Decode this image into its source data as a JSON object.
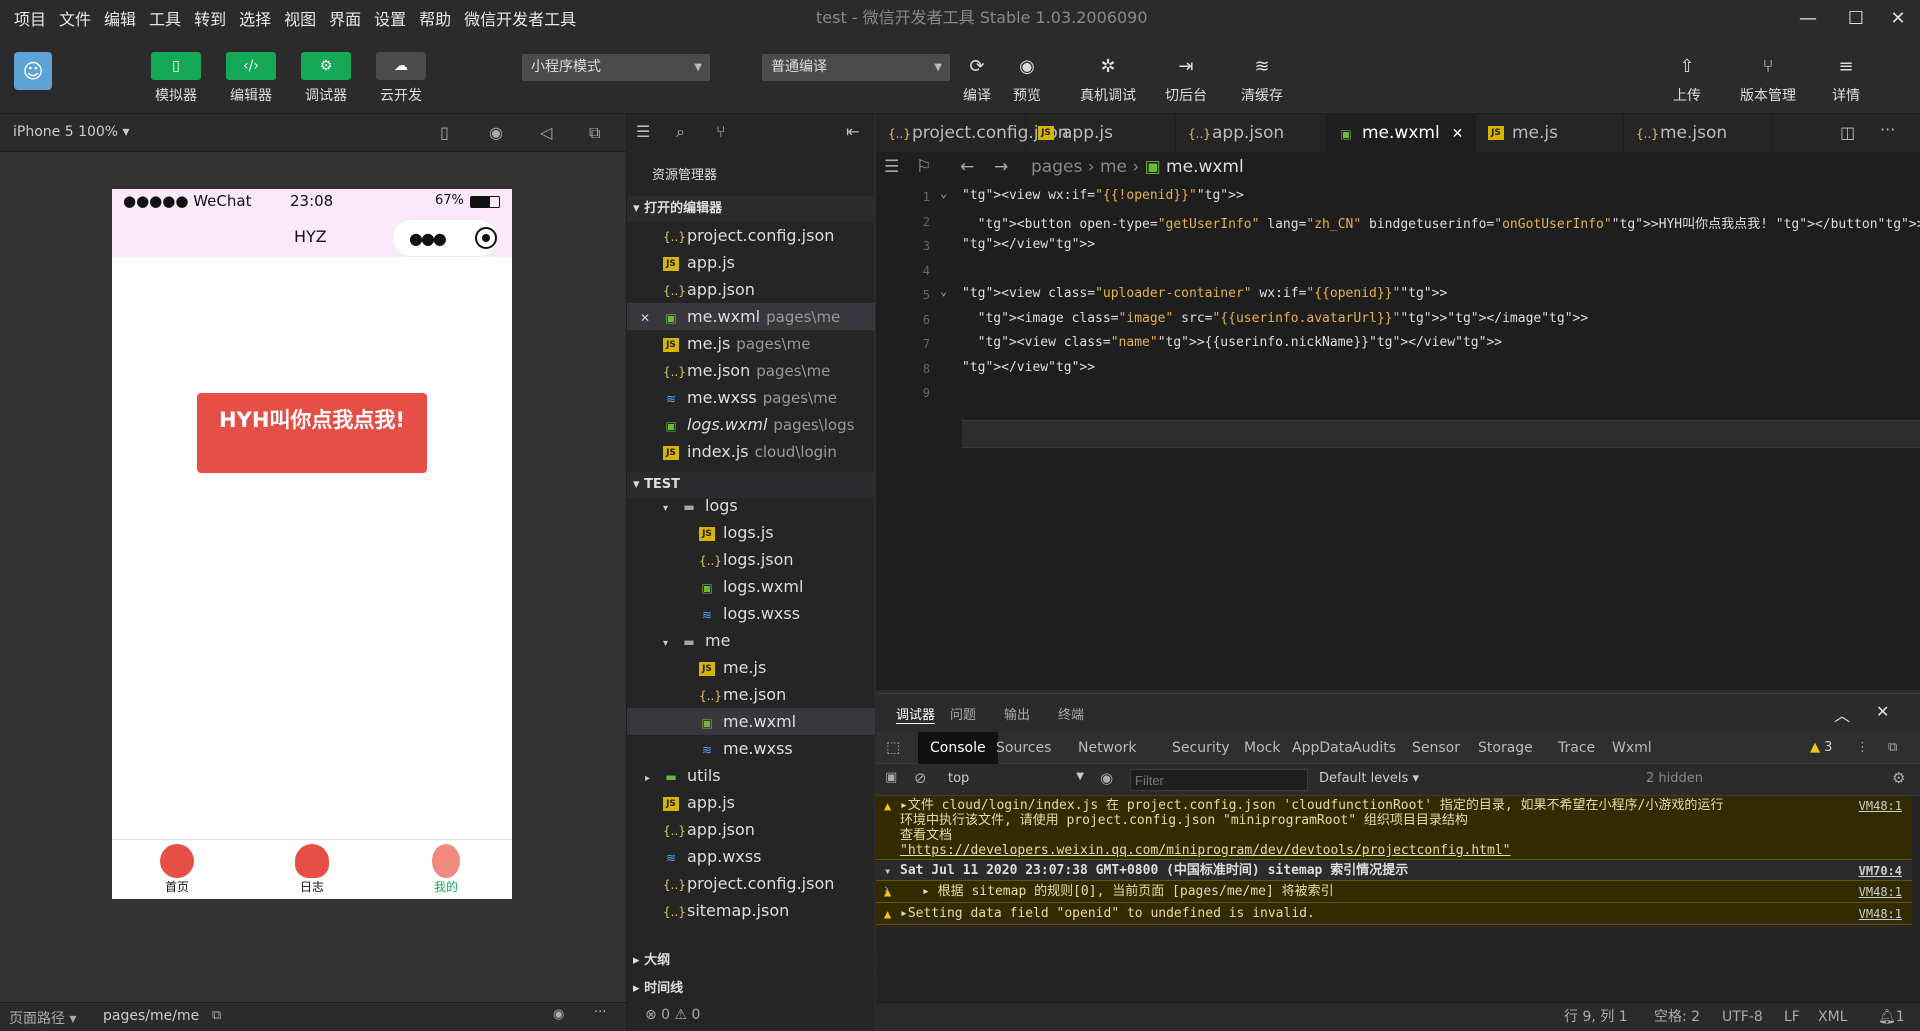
{
  "menu": [
    "项目",
    "文件",
    "编辑",
    "工具",
    "转到",
    "选择",
    "视图",
    "界面",
    "设置",
    "帮助",
    "微信开发者工具"
  ],
  "window_title": "test - 微信开发者工具 Stable 1.03.2006090",
  "toolbar": {
    "simulator": "模拟器",
    "editor": "编辑器",
    "debugger": "调试器",
    "cloud": "云开发",
    "mode_select": "小程序模式",
    "compile_select": "普通编译",
    "compile": "编译",
    "preview": "预览",
    "real_debug": "真机调试",
    "switch_bg": "切后台",
    "clear_cache": "清缓存",
    "upload": "上传",
    "version": "版本管理",
    "details": "详情"
  },
  "simulator": {
    "device": "iPhone 5 100%",
    "status_carrier": "●●●●● WeChat",
    "status_time": "23:08",
    "status_battery": "67%",
    "nav_title": "HYZ",
    "button_text": "HYH叫你点我点我!",
    "tabs": [
      {
        "label": "首页",
        "color": "#111111"
      },
      {
        "label": "日志",
        "color": "#111111"
      },
      {
        "label": "我的",
        "color": "#14a857"
      }
    ],
    "footer_path_label": "页面路径",
    "footer_path": "pages/me/me"
  },
  "explorer": {
    "title": "资源管理器",
    "open_editors_header": "打开的编辑器",
    "open_editors": [
      {
        "name": "project.config.json",
        "sub": "",
        "type": "json"
      },
      {
        "name": "app.js",
        "sub": "",
        "type": "js"
      },
      {
        "name": "app.json",
        "sub": "",
        "type": "json"
      },
      {
        "name": "me.wxml",
        "sub": "pages\\me",
        "type": "wxml"
      },
      {
        "name": "me.js",
        "sub": "pages\\me",
        "type": "js"
      },
      {
        "name": "me.json",
        "sub": "pages\\me",
        "type": "json"
      },
      {
        "name": "me.wxss",
        "sub": "pages\\me",
        "type": "wxss"
      },
      {
        "name": "logs.wxml",
        "sub": "pages\\logs",
        "type": "wxml"
      },
      {
        "name": "index.js",
        "sub": "cloud\\login",
        "type": "js"
      }
    ],
    "project_header": "TEST",
    "tree": [
      {
        "name": "logs",
        "indent": 2,
        "type": "fold"
      },
      {
        "name": "logs.js",
        "indent": 3,
        "type": "js"
      },
      {
        "name": "logs.json",
        "indent": 3,
        "type": "json"
      },
      {
        "name": "logs.wxml",
        "indent": 3,
        "type": "wxml"
      },
      {
        "name": "logs.wxss",
        "indent": 3,
        "type": "wxss"
      },
      {
        "name": "me",
        "indent": 2,
        "type": "fold"
      },
      {
        "name": "me.js",
        "indent": 3,
        "type": "js"
      },
      {
        "name": "me.json",
        "indent": 3,
        "type": "json"
      },
      {
        "name": "me.wxml",
        "indent": 3,
        "type": "wxml"
      },
      {
        "name": "me.wxss",
        "indent": 3,
        "type": "wxss"
      },
      {
        "name": "utils",
        "indent": 1,
        "type": "fold"
      },
      {
        "name": "app.js",
        "indent": 1,
        "type": "js"
      },
      {
        "name": "app.json",
        "indent": 1,
        "type": "json"
      },
      {
        "name": "app.wxss",
        "indent": 1,
        "type": "wxss"
      },
      {
        "name": "project.config.json",
        "indent": 1,
        "type": "json"
      },
      {
        "name": "sitemap.json",
        "indent": 1,
        "type": "json"
      }
    ],
    "outline": "大纲",
    "timeline": "时间线",
    "problems_count": "⊗ 0 ⚠ 0"
  },
  "editor": {
    "tabs": [
      "project.config.json",
      "app.js",
      "app.json",
      "me.wxml",
      "me.js",
      "me.json"
    ],
    "breadcrumb": [
      "pages",
      "me",
      "me.wxml"
    ],
    "lines": [
      {
        "n": "1",
        "code": "<view wx:if=\"{{!openid}}\">"
      },
      {
        "n": "2",
        "code": "  <button open-type=\"getUserInfo\" lang=\"zh_CN\" bindgetuserinfo=\"onGotUserInfo\">HYH叫你点我点我! </button>"
      },
      {
        "n": "3",
        "code": "</view>"
      },
      {
        "n": "4",
        "code": ""
      },
      {
        "n": "5",
        "code": "<view class=\"uploader-container\" wx:if=\"{{openid}}\">"
      },
      {
        "n": "6",
        "code": "  <image class=\"image\" src=\"{{userinfo.avatarUrl}}\"></image>"
      },
      {
        "n": "7",
        "code": "  <view class=\"name\">{{userinfo.nickName}}</view>"
      },
      {
        "n": "8",
        "code": "</view>"
      },
      {
        "n": "9",
        "code": ""
      }
    ]
  },
  "debugger": {
    "panel_tabs": [
      "调试器",
      "问题",
      "输出",
      "终端"
    ],
    "dev_tabs": [
      "Console",
      "Sources",
      "Network",
      "Security",
      "Mock",
      "AppData",
      "Audits",
      "Sensor",
      "Storage",
      "Trace",
      "Wxml"
    ],
    "warn_count": "3",
    "context": "top",
    "filter_placeholder": "Filter",
    "levels": "Default levels",
    "hidden": "2 hidden",
    "messages": [
      {
        "text1": "▸文件 cloud/login/index.js 在 project.config.json 'cloudfunctionRoot' 指定的目录, 如果不希望在小程序/小游戏的运行",
        "text2": "环境中执行该文件, 请使用 project.config.json \"miniprogramRoot\" 组织项目目录结构",
        "text3": "查看文档",
        "text4": "\"https://developers.weixin.qq.com/miniprogram/dev/devtools/projectconfig.html\"",
        "src": "VM48:1"
      },
      {
        "text1": "Sat Jul 11 2020 23:07:38 GMT+0800 (中国标准时间) sitemap 索引情况提示",
        "src": "VM70:4"
      },
      {
        "text1": "▸ 根据 sitemap 的规则[0], 当前页面 [pages/me/me] 将被索引",
        "src": "VM48:1"
      },
      {
        "text1": "▸Setting data field \"openid\" to undefined is invalid.",
        "src": "VM48:1"
      }
    ]
  },
  "statusbar": {
    "position": "行 9, 列 1",
    "spaces": "空格: 2",
    "encoding": "UTF-8",
    "eol": "LF",
    "lang": "XML",
    "notif": "1"
  }
}
